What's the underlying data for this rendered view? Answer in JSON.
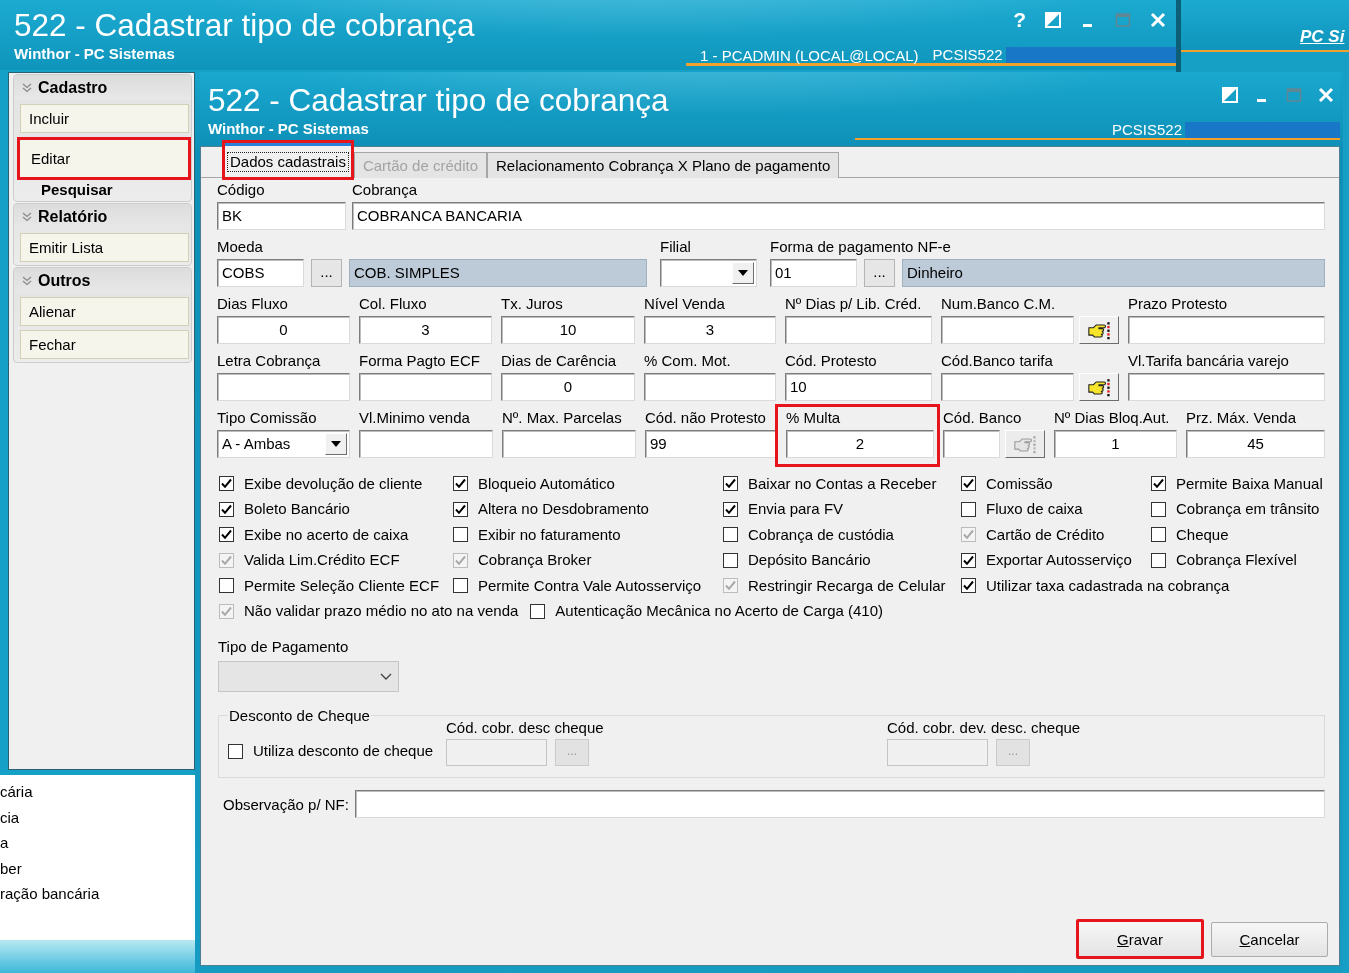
{
  "main_window": {
    "title": "522 - Cadastrar tipo de cobrança",
    "subtitle": "Winthor - PC Sistemas",
    "help": "?",
    "session": "1 - PCADMIN (LOCAL@LOCAL)",
    "program": "PCSIS522"
  },
  "side_window": {
    "title": "PC Si"
  },
  "sidebar": {
    "sections": [
      {
        "title": "Cadastro",
        "expanded": true,
        "items": [
          {
            "label": "Incluir",
            "active": false,
            "highlighted": false
          },
          {
            "label": "Editar",
            "active": false,
            "highlighted": true
          },
          {
            "label": "Pesquisar",
            "active": true,
            "highlighted": false
          }
        ]
      },
      {
        "title": "Relatório",
        "expanded": true,
        "items": [
          {
            "label": "Emitir Lista",
            "active": false,
            "highlighted": false
          }
        ]
      },
      {
        "title": "Outros",
        "expanded": true,
        "items": [
          {
            "label": "Alienar",
            "active": false,
            "highlighted": false
          },
          {
            "label": "Fechar",
            "active": false,
            "highlighted": false
          }
        ]
      }
    ]
  },
  "background_list": [
    "cária",
    "cia",
    "a",
    "ber",
    "ração bancária"
  ],
  "dialog": {
    "title": "522 - Cadastrar tipo de cobrança",
    "subtitle": "Winthor - PC Sistemas",
    "program": "PCSIS522",
    "tabs": [
      {
        "label": "Dados cadastrais",
        "selected": true,
        "disabled": false,
        "highlighted": true
      },
      {
        "label": "Cartão de crédito",
        "selected": false,
        "disabled": true,
        "highlighted": false
      },
      {
        "label": "Relacionamento Cobrança X Plano de pagamento",
        "selected": false,
        "disabled": false,
        "highlighted": false
      }
    ],
    "field_rows": [
      [
        {
          "label": "Código",
          "kind": "text",
          "value": "BK",
          "highlighted": false
        },
        {
          "label": "Cobrança",
          "kind": "text",
          "value": "COBRANCA BANCARIA",
          "highlighted": false
        }
      ],
      [
        {
          "label": "Moeda",
          "kind": "lookup",
          "code": "COBS",
          "button": "...",
          "description": "COB. SIMPLES",
          "highlighted": false
        },
        {
          "label": "Filial",
          "kind": "select",
          "highlighted": false
        },
        {
          "label": "Forma de pagamento NF-e",
          "kind": "lookup",
          "code": "01",
          "button": "...",
          "description": "Dinheiro",
          "highlighted": false
        }
      ],
      [
        {
          "label": "Dias Fluxo",
          "kind": "number",
          "value": "0",
          "highlighted": false
        },
        {
          "label": "Col. Fluxo",
          "kind": "number",
          "value": "3",
          "highlighted": false
        },
        {
          "label": "Tx. Juros",
          "kind": "number",
          "value": "10",
          "highlighted": false
        },
        {
          "label": "Nível Venda",
          "kind": "number",
          "value": "3",
          "highlighted": false
        },
        {
          "label": "Nº Dias p/ Lib. Créd.",
          "kind": "text",
          "highlighted": false
        },
        {
          "label": "Num.Banco C.M.",
          "kind": "picker",
          "button_disabled": false,
          "highlighted": false
        },
        {
          "label": "Prazo Protesto",
          "kind": "text",
          "highlighted": false
        }
      ],
      [
        {
          "label": "Letra Cobrança",
          "kind": "text",
          "highlighted": false
        },
        {
          "label": "Forma Pagto ECF",
          "kind": "text",
          "highlighted": false
        },
        {
          "label": "Dias de Carência",
          "kind": "number",
          "value": "0",
          "highlighted": false
        },
        {
          "label": "% Com. Mot.",
          "kind": "text",
          "highlighted": false
        },
        {
          "label": "Cód. Protesto",
          "kind": "text",
          "value": "10",
          "highlighted": false
        },
        {
          "label": "Cód.Banco tarifa",
          "kind": "picker",
          "button_disabled": false,
          "highlighted": false
        },
        {
          "label": "Vl.Tarifa bancária varejo",
          "kind": "text",
          "highlighted": false
        }
      ],
      [
        {
          "label": "Tipo Comissão",
          "kind": "select",
          "value": "A - Ambas",
          "highlighted": false
        },
        {
          "label": "Vl.Minimo venda",
          "kind": "text",
          "highlighted": false
        },
        {
          "label": "Nº. Max. Parcelas",
          "kind": "text",
          "highlighted": false
        },
        {
          "label": "Cód. não Protesto",
          "kind": "text",
          "value": "99",
          "highlighted": false
        },
        {
          "label": "% Multa",
          "kind": "number",
          "value": "2",
          "highlighted": true
        },
        {
          "label": "Cód. Banco",
          "kind": "picker",
          "button_disabled": true,
          "highlighted": false
        },
        {
          "label": "Nº Dias Bloq.Aut.",
          "kind": "number",
          "value": "1",
          "highlighted": false
        },
        {
          "label": "Prz. Máx. Venda",
          "kind": "number",
          "value": "45",
          "highlighted": false
        }
      ]
    ],
    "checkbox_rows": [
      [
        {
          "label": "Exibe devolução de cliente",
          "checked": true,
          "disabled": false
        },
        {
          "label": "Bloqueio Automático",
          "checked": true,
          "disabled": false
        },
        {
          "label": "Baixar no Contas a Receber",
          "checked": true,
          "disabled": false
        },
        {
          "label": "Comissão",
          "checked": true,
          "disabled": false
        },
        {
          "label": "Permite Baixa Manual",
          "checked": true,
          "disabled": false
        }
      ],
      [
        {
          "label": "Boleto Bancário",
          "checked": true,
          "disabled": false
        },
        {
          "label": "Altera no Desdobramento",
          "checked": true,
          "disabled": false
        },
        {
          "label": "Envia para FV",
          "checked": true,
          "disabled": false
        },
        {
          "label": "Fluxo de caixa",
          "checked": false,
          "disabled": false
        },
        {
          "label": "Cobrança em trânsito",
          "checked": false,
          "disabled": false
        }
      ],
      [
        {
          "label": "Exibe no acerto de caixa",
          "checked": true,
          "disabled": false
        },
        {
          "label": "Exibir no faturamento",
          "checked": false,
          "disabled": false
        },
        {
          "label": "Cobrança de custódia",
          "checked": false,
          "disabled": false
        },
        {
          "label": "Cartão de Crédito",
          "checked": true,
          "disabled": true
        },
        {
          "label": "Cheque",
          "checked": false,
          "disabled": false
        }
      ],
      [
        {
          "label": "Valida Lim.Crédito ECF",
          "checked": true,
          "disabled": true
        },
        {
          "label": "Cobrança Broker",
          "checked": true,
          "disabled": true
        },
        {
          "label": "Depósito Bancário",
          "checked": false,
          "disabled": false
        },
        {
          "label": "Exportar Autosserviço",
          "checked": true,
          "disabled": false
        },
        {
          "label": "Cobrança Flexível",
          "checked": false,
          "disabled": false
        }
      ],
      [
        {
          "label": "Permite Seleção Cliente ECF",
          "checked": false,
          "disabled": false
        },
        {
          "label": "Permite Contra Vale Autosserviço",
          "checked": false,
          "disabled": false
        },
        {
          "label": "Restringir Recarga de Celular",
          "checked": true,
          "disabled": true
        },
        {
          "label": "Utilizar taxa cadastrada na cobrança",
          "checked": true,
          "disabled": false
        }
      ],
      [
        {
          "label": "Não validar prazo médio no ato na venda",
          "checked": true,
          "disabled": true
        },
        {
          "label": "Autenticação Mecânica no Acerto de Carga (410)",
          "checked": false,
          "disabled": false
        }
      ]
    ],
    "payment_type": {
      "label": "Tipo de Pagamento",
      "disabled": true
    },
    "cheque_group": {
      "title": "Desconto de Cheque",
      "option": {
        "label": "Utiliza desconto de cheque",
        "checked": false
      },
      "fields": [
        {
          "label": "Cód. cobr. desc cheque",
          "button": "...",
          "disabled": true
        },
        {
          "label": "Cód. cobr. dev. desc. cheque",
          "button": "...",
          "disabled": true
        }
      ]
    },
    "note": {
      "label": "Observação p/ NF:"
    },
    "buttons": [
      {
        "label": "Gravar",
        "highlighted": true
      },
      {
        "label": "Cancelar",
        "highlighted": false
      }
    ]
  }
}
